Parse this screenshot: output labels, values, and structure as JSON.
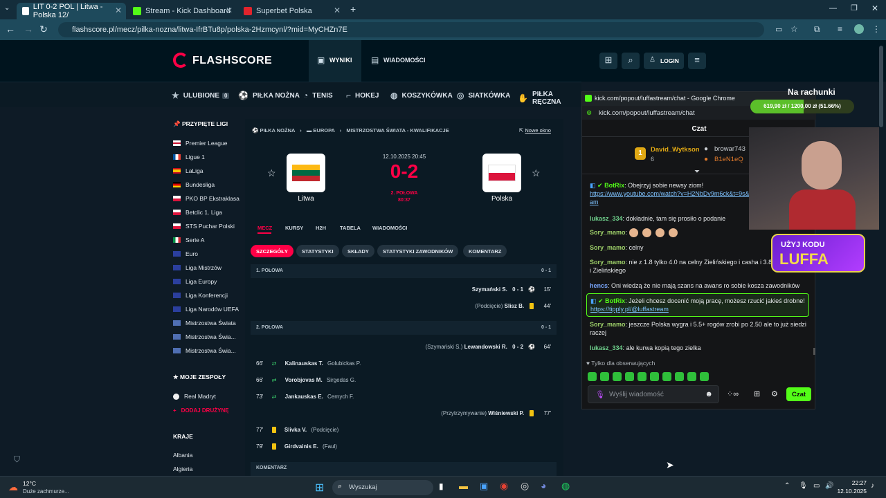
{
  "browser": {
    "tabs": [
      {
        "title": "LIT 0-2 POL | Litwa - Polska 12/"
      },
      {
        "title": "Stream - Kick Dashboard"
      },
      {
        "title": "Superbet Polska"
      }
    ],
    "url": "flashscore.pl/mecz/pilka-nozna/litwa-IfrBTu8p/polska-2Hzmcynl/?mid=MyCHZn7E"
  },
  "fs_header": {
    "logo": "FLASHSCORE",
    "nav": [
      {
        "label": "WYNIKI"
      },
      {
        "label": "WIADOMOŚCI"
      }
    ],
    "login": "LOGIN"
  },
  "sports_nav": {
    "favorites": "ULUBIONE",
    "favorites_count": "0",
    "items": [
      "PIŁKA NOŻNA",
      "TENIS",
      "HOKEJ",
      "KOSZYKÓWKA",
      "SIATKÓWKA",
      "PIŁKA RĘCZNA"
    ]
  },
  "sidebar": {
    "pinned_title": "PRZYPIĘTE LIGI",
    "leagues": [
      "Premier League",
      "Ligue 1",
      "LaLiga",
      "Bundesliga",
      "PKO BP Ekstraklasa",
      "Betclic 1. Liga",
      "STS Puchar Polski",
      "Serie A",
      "Euro",
      "Liga Mistrzów",
      "Liga Europy",
      "Liga Konferencji",
      "Liga Narodów UEFA",
      "Mistrzostwa Świata",
      "Mistrzostwa Świa...",
      "Mistrzostwa Świa..."
    ],
    "teams_title": "MOJE ZESPOŁY",
    "team": "Real Madryt",
    "add_team": "DODAJ DRUŻYNĘ",
    "countries_title": "KRAJE",
    "countries": [
      "Albania",
      "Algieria"
    ]
  },
  "match": {
    "breadcrumb": [
      "PIŁKA NOŻNA",
      "EUROPA",
      "MISTRZOSTWA ŚWIATA - KWALIFIKACJE"
    ],
    "new_window": "Nowe okno",
    "date": "12.10.2025 20:45",
    "score": "0-2",
    "status": "2. POŁOWA",
    "clock": "80:37",
    "home": "Litwa",
    "away": "Polska",
    "tabs": [
      "MECZ",
      "KURSY",
      "H2H",
      "TABELA",
      "WIADOMOŚCI"
    ],
    "subtabs": [
      "SZCZEGÓŁY",
      "STATYSTYKI",
      "SKŁADY",
      "STATYSTYKI ZAWODNIKÓW",
      "KOMENTARZ"
    ],
    "half1_label": "1. POŁOWA",
    "half1_score": "0 - 1",
    "half2_label": "2. POŁOWA",
    "half2_score": "0 - 1",
    "commentary_label": "KOMENTARZ",
    "events_away": [
      {
        "text": "Szymański S.",
        "score": "0 - 1",
        "min": "15'"
      },
      {
        "note": "(Podcięcie)",
        "text": "Slisz B.",
        "min": "44'"
      },
      {
        "note": "(Szymański S.)",
        "text": "Lewandowski R.",
        "score": "0 - 2",
        "min": "64'"
      },
      {
        "note": "(Przytrzymywanie)",
        "text": "Wiśniewski P.",
        "min": "77'"
      }
    ],
    "events_home": [
      {
        "min": "66'",
        "in": "Kalinauskas T.",
        "out": "Golubickas P."
      },
      {
        "min": "66'",
        "in": "Vorobjovas M.",
        "out": "Sirgedas G."
      },
      {
        "min": "73'",
        "in": "Jankauskas E.",
        "out": "Cernych F."
      },
      {
        "min": "77'",
        "in": "Slivka V.",
        "out": "(Podcięcie)"
      },
      {
        "min": "79'",
        "in": "Girdvainis E.",
        "out": "(Faul)"
      }
    ]
  },
  "kick": {
    "window_title": "kick.com/popout/luffastream/chat - Google Chrome",
    "url": "kick.com/popout/luffastream/chat",
    "chat_title": "Czat",
    "top_user": "David_Wytkson",
    "top_count": "6",
    "gifter1": "browar743",
    "gifter2": "B1eN1eQ",
    "followers_only": "Tylko dla obserwujących",
    "input_placeholder": "Wyślij wiadomość",
    "send": "Czat",
    "messages": [
      {
        "user": "BotRix",
        "text": "Obejrzyj sobie newsy ziom!",
        "link": "https://www.youtube.com/watch?v=H2NbDv9m6ck&t=9s&ab_channel=Luffastream"
      },
      {
        "user": "lukasz_334",
        "text": "dokładnie, tam się prosiło o podanie"
      },
      {
        "user": "Sory_mamo",
        "text": ""
      },
      {
        "user": "Sory_mamo",
        "text": "celny"
      },
      {
        "user": "Sory_mamo",
        "text": "nie z 1.8 tylko 4.0 na celny Zielińskiego i casha i 3.8 Kamińskiego i Zielińskiego"
      },
      {
        "user": "hencs",
        "text": "Oni wiedzą że nie mają szans na awans ro sobie kosza zawodników"
      },
      {
        "user": "BotRix",
        "text": "Jeżeli chcesz docenić moją pracę, możesz rzucić jakieś drobne!",
        "link": "https://tipply.pl/@luffastream"
      },
      {
        "user": "Sory_mamo",
        "text": "jeszcze Polska wygra i 5.5+ rogów zrobi po 2.50 ale to już siedzi raczej"
      },
      {
        "user": "lukasz_334",
        "text": "ale kurwa kopią tego zielka"
      }
    ]
  },
  "overlay": {
    "title": "Na rachunki",
    "progress_text": "619,90 zł / 1200,00 zł (51.66%)",
    "progress": 0.5166,
    "promo_line1": "UŻYJ KODU",
    "promo_line2": "LUFFA"
  },
  "taskbar": {
    "temp": "12°C",
    "weather": "Duże zachmurze...",
    "search": "Wyszukaj",
    "time": "22:27",
    "date": "12.10.2025"
  }
}
